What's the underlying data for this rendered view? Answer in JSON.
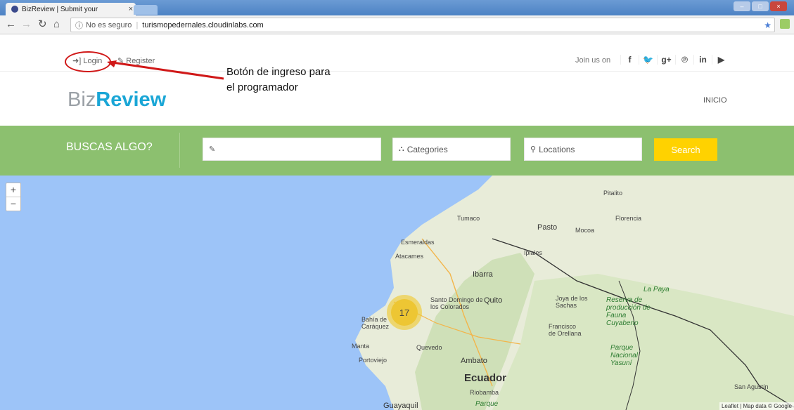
{
  "browser": {
    "tab_title": "BizReview | Submit your",
    "tab_close": "×",
    "security": "No es seguro",
    "url": "turismopedernales.cloudinlabs.com"
  },
  "topbar": {
    "login": "Login",
    "register": "Register",
    "join_us": "Join us on",
    "social": [
      "f",
      "y",
      "g+",
      "p",
      "in",
      "yt"
    ]
  },
  "annotation": {
    "line1": "Botón de ingreso para",
    "line2": "el programador"
  },
  "header": {
    "logo_part1": "Biz",
    "logo_part2": "Review",
    "nav_inicio": "INICIO"
  },
  "search": {
    "heading": "BUSCAS ALGO?",
    "keyword_value": "",
    "categories": "Categories",
    "locations": "Locations",
    "button": "Search"
  },
  "map": {
    "zoom_in": "+",
    "zoom_out": "−",
    "cluster_count": "17",
    "labels": {
      "tumaco": "Tumaco",
      "pitalito": "Pitalito",
      "florencia": "Florencia",
      "pasto": "Pasto",
      "mocoa": "Mocoa",
      "esmeraldas": "Esmeraldas",
      "atacames": "Atacames",
      "ipiales": "Ipiales",
      "ibarra": "Ibarra",
      "quito": "Quito",
      "santo_domingo": "Santo Domingo de los Colorados",
      "bahia": "Bahía de Caráquez",
      "manta": "Manta",
      "portoviejo": "Portoviejo",
      "quevedo": "Quevedo",
      "ambato": "Ambato",
      "riobamba": "Riobamba",
      "ecuador": "Ecuador",
      "guayaquil": "Guayaquil",
      "joya": "Joya de los Sachas",
      "francisco": "Francisco de Orellana",
      "la_paya": "La Paya",
      "cuyabeno": "Reserva de producción de Fauna Cuyabeno",
      "yasuni": "Parque Nacional Yasuní",
      "san_agustin": "San Agustín",
      "parque": "Parque"
    },
    "attribution": "Leaflet | Map data © Google"
  },
  "colors": {
    "band_green": "#8cc06f",
    "search_yellow": "#ffd200",
    "logo_blue": "#1aa6d6",
    "annotation_red": "#d01818",
    "sea": "#9dc4f8"
  }
}
